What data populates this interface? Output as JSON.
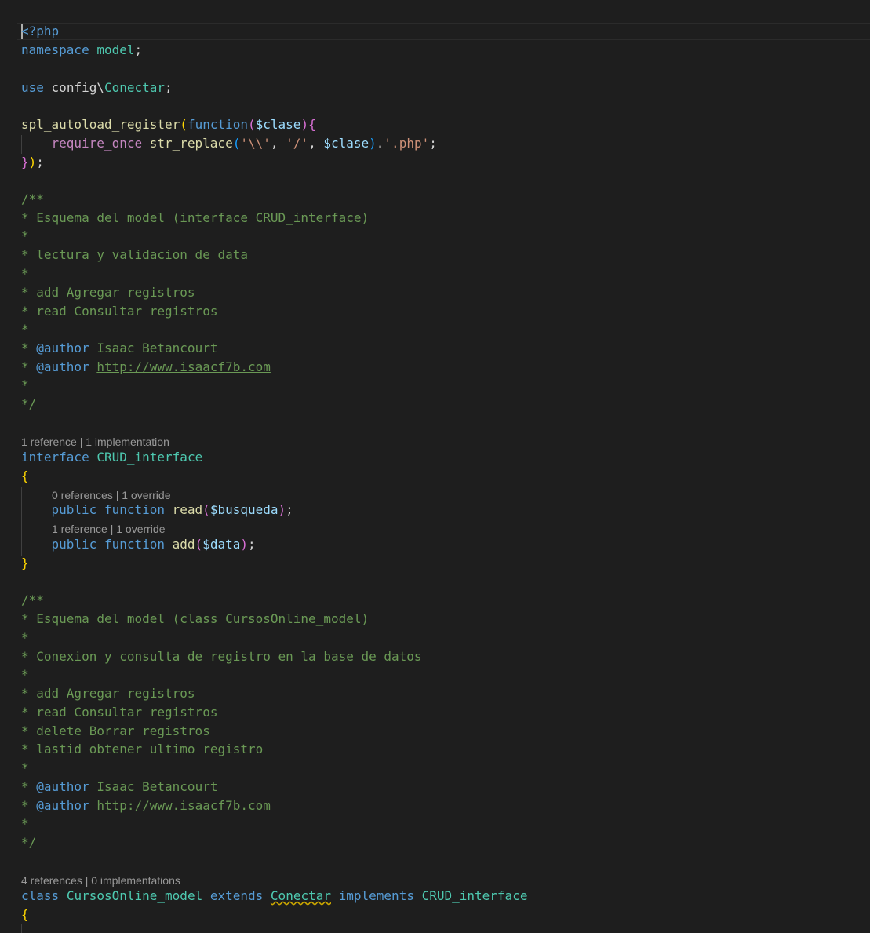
{
  "editor": {
    "open_tag": "<?php",
    "ns_keyword": "namespace",
    "ns_name": "model",
    "semicolon": ";",
    "use_keyword": "use",
    "use_path": "config\\",
    "use_class": "Conectar",
    "autoload_fn": "spl_autoload_register",
    "function_kw": "function",
    "param_clase": "$clase",
    "require_kw": "require_once",
    "str_replace_fn": "str_replace",
    "str_backslash": "'\\\\'",
    "str_slash": "'/'",
    "str_php_ext": "'.php'",
    "comma": ",",
    "dot": ".",
    "open_paren": "(",
    "close_paren": ")",
    "open_brace": "{",
    "close_brace": "}",
    "close_brace_paren_semi": "});",
    "doc1": {
      "open": "/**",
      "title": "* Esquema del model (interface CRUD_interface)",
      "star": "*",
      "desc": "* lectura y validacion de data",
      "add": "* add Agregar registros",
      "read": "* read Consultar registros",
      "author_prefix": "* ",
      "author_tag": "@author",
      "author_name": " Isaac Betancourt",
      "author_url": "http://www.isaacf7b.com",
      "close": "*/"
    },
    "lens_interface": "1 reference | 1 implementation",
    "interface_kw": "interface",
    "interface_name": "CRUD_interface",
    "lens_read": "0 references | 1 override",
    "public_kw": "public",
    "read_fn": "read",
    "param_busqueda": "$busqueda",
    "lens_add": "1 reference | 1 override",
    "add_fn": "add",
    "param_data": "$data",
    "doc2": {
      "open": "/**",
      "title": "* Esquema del model (class CursosOnline_model)",
      "star": "*",
      "desc": "* Conexion y consulta de registro en la base de datos",
      "add": "* add Agregar registros",
      "read": "* read Consultar registros",
      "delete": "* delete Borrar registros",
      "lastid": "* lastid obtener ultimo registro",
      "author_prefix": "* ",
      "author_tag": "@author",
      "author_name": " Isaac Betancourt",
      "author_url": "http://www.isaacf7b.com",
      "close": "*/"
    },
    "lens_class": "4 references | 0 implementations",
    "class_kw": "class",
    "class_name": "CursosOnline_model",
    "extends_kw": "extends",
    "extends_name": "Conectar",
    "implements_kw": "implements",
    "implements_name": "CRUD_interface"
  },
  "colors": {
    "background": "#1e1e1e",
    "keyword": "#569cd6",
    "control": "#c586c0",
    "function": "#dcdcaa",
    "variable": "#9cdcfe",
    "type": "#4ec9b0",
    "string": "#ce9178",
    "comment": "#6a9955",
    "bracket_1": "#ffd700",
    "bracket_2": "#da70d6",
    "codelens": "#999999"
  }
}
